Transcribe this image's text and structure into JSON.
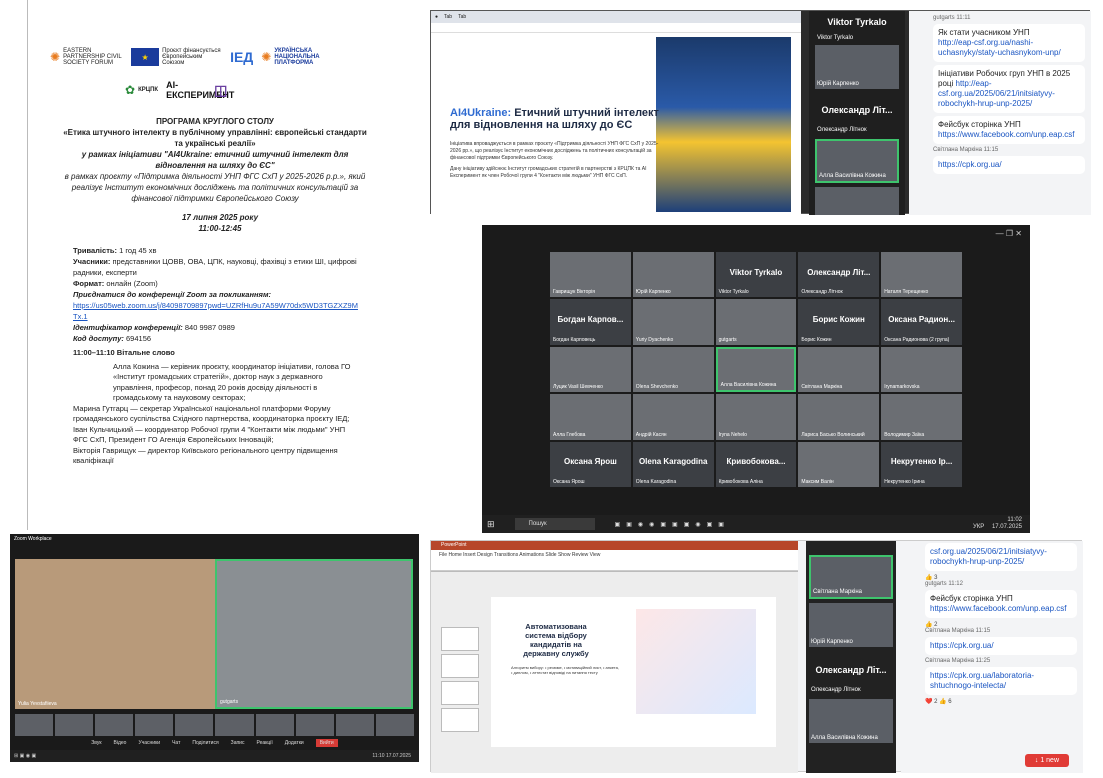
{
  "doc": {
    "logos": [
      "EASTERN PARTNERSHIP CIVIL SOCIETY FORUM",
      "Проєкт фінансується Європейським Союзом",
      "ІЕД",
      "УКРАЇНСЬКА НАЦІОНАЛЬНА ПЛАТФОРМА",
      "КРЦПК",
      "AI-ЕКСПЕРИМЕНТ"
    ],
    "title1": "ПРОГРАМА КРУГЛОГО СТОЛУ",
    "title2": "«Етика штучного інтелекту в публічному управлінні: європейські стандарти та українські реалії»",
    "title3": "у рамках ініціативи \"AI4Ukraine: етичний штучний інтелект для відновлення на шляху до ЄС\"",
    "title4": "в рамках проєкту «Підтримка діяльності УНП ФГС СхП у 2025-2026 р.р.», який реалізує Інститут економічних досліджень та політичних консультацій за фінансової підтримки Європейського Союзу",
    "date": "17 липня 2025 року",
    "time": "11:00-12:45",
    "duration_label": "Тривалість:",
    "duration": "1 год 45 хв",
    "participants_label": "Учасники:",
    "participants": "представники ЦОВВ, ОВА, ЦПК, науковці, фахівці з етики ШІ, цифрові радники, експерти",
    "format_label": "Формат:",
    "format": "онлайн (Zoom)",
    "join_label": "Приєднатися до конференції Zoom за покликанням:",
    "join_link": "https://us05web.zoom.us/j/84098709897pwd=UZRfHu9u7A59W70dx5WD3TGZXZ9MTx.1",
    "id_label": "Ідентифікатор конференції:",
    "id": "840 9987 0989",
    "code_label": "Код доступу:",
    "code": "694156",
    "agenda_head": "11:00–11:10 Вітальне слово",
    "agenda_1": "Алла Кожина — керівник проєкту, координатор ініціативи, голова ГО «Інститут громадських стратегій», доктор наук з державного управління, професор, понад 20 років досвіду діяльності в громадському та науковому секторах;",
    "agenda_2": "Марина Гутгарц — секретар Української національної платформи Форуму громадянського суспільства Східного партнерства, координаторка проєкту ІЕД;",
    "agenda_3": "Іван Кульчицький — координатор Робочої групи 4 \"Контакти між людьми\" УНП ФГС СхП, Президент ГО Агенція Європейських Інновацій;",
    "agenda_4": "Вікторія Гаврищук — директор Київського регіонального центру підвищення кваліфікації"
  },
  "screen1": {
    "slide_title_a": "AI4Ukraine:",
    "slide_title_b": "Етичний штучний інтелект для відновлення на шляху до ЄС",
    "slide_text": "Ініціатива впроваджується в рамках проєкту «Підтримка діяльності УНП ФГС СхП у 2025-2026 рр.», що реалізує Інститут економічних досліджень та політичних консультацій за фінансової підтримки Європейського Союзу.",
    "slide_text2": "Дану ініціативу здійснює Інститут громадських стратегій в партнерстві з КРЦПК та AI Експеримент як член Робочої групи 4 \"Контакти між людьми\" УНП ФГС СхП.",
    "speakers": [
      {
        "name": "Viktor Tyrkalo",
        "label": "Viktor Tyrkalo"
      },
      {
        "name": "",
        "label": "Юрій Карпенко"
      },
      {
        "name": "Олександр Літ...",
        "label": "Олександр Літнок"
      },
      {
        "name": "",
        "label": "Алла Василівна Кожина"
      }
    ],
    "chat": {
      "sender0": "gutgarts 11:11",
      "msg1": "Як стати учасником УНП",
      "link1": "http://eap-csf.org.ua/nashi-uchasnyky/staty-uchasnykom-unp/",
      "msg2": "Ініціативи Робочих груп УНП в 2025 році",
      "link2": "http://eap-csf.org.ua/2025/06/21/initsiatyvy-robochykh-hrup-unp-2025/",
      "msg3": "Фейсбук сторінка УНП",
      "link3": "https://www.facebook.com/unp.eap.csf",
      "sender1": "Світлана Маркіна 11:15",
      "link4": "https://cpk.org.ua/"
    }
  },
  "screen2": {
    "tiles": [
      {
        "name": "",
        "label": "Гаврищук Вікторія"
      },
      {
        "name": "",
        "label": "Юрій Карпенко"
      },
      {
        "name": "Viktor Tyrkalo",
        "label": "Viktor Tyrkalo"
      },
      {
        "name": "Олександр Літ...",
        "label": "Олександр Літнок"
      },
      {
        "name": "",
        "label": "Наталя Терещенко"
      },
      {
        "name": "Богдан Карпов...",
        "label": "Богдан Карповець"
      },
      {
        "name": "",
        "label": "Yuriy Dyachenko"
      },
      {
        "name": "",
        "label": "gutgarts"
      },
      {
        "name": "Борис Кожин",
        "label": "Борис Кожин"
      },
      {
        "name": "Оксана Радион...",
        "label": "Оксана Радионова (2 група)"
      },
      {
        "name": "",
        "label": "Луцик Vasil Шевченко"
      },
      {
        "name": "",
        "label": "Olena Shevchenko"
      },
      {
        "name": "",
        "label": "Алла Василівна Кожина"
      },
      {
        "name": "",
        "label": "Світлана Маркіна"
      },
      {
        "name": "",
        "label": "Irynamarkovska"
      },
      {
        "name": "",
        "label": "Алла Глебова"
      },
      {
        "name": "",
        "label": "Андрій Касян"
      },
      {
        "name": "",
        "label": "Iryna Nehelo"
      },
      {
        "name": "",
        "label": "Лариса Басько Волинський"
      },
      {
        "name": "",
        "label": "Володимир Заїка"
      },
      {
        "name": "Оксана Ярош",
        "label": "Оксана Ярош"
      },
      {
        "name": "Olena Karagodina",
        "label": "Olena Karagodina"
      },
      {
        "name": "Кривобокова...",
        "label": "Кривобокова Аліна"
      },
      {
        "name": "",
        "label": "Максим Валін"
      },
      {
        "name": "Некрутенко Ір...",
        "label": "Некрутенко Ірина"
      }
    ],
    "search": "Пошук",
    "time": "11:02",
    "date": "17.07.2025",
    "lang": "УКР"
  },
  "screen3": {
    "app": "Zoom Workplace",
    "left_label": "Yulia Yevstafiieva",
    "right_label": "gutgarts",
    "controls": [
      "Звук",
      "Відео",
      "Учасники",
      "Чат",
      "Поділитися",
      "Запис",
      "Реакції",
      "Додатки",
      "Вийти"
    ],
    "time": "11:10",
    "date": "17.07.2025"
  },
  "screen4": {
    "ppt_title": "Автоматизована система відбору кандидатів на державну службу",
    "ppt_list": "Алгоритм вибору: • резюме, • мотиваційний лист, • анкета, • диплом, • аттестат відповіді на питання тесту",
    "speakers": [
      {
        "name": "",
        "label": "Світлана Маркіна"
      },
      {
        "name": "",
        "label": "Юрій Карпенко"
      },
      {
        "name": "Олександр Літ...",
        "label": "Олександр Літнок"
      },
      {
        "name": "",
        "label": "Алла Василівна Кожина"
      }
    ],
    "chat": {
      "link0": "csf.org.ua/2025/06/21/initsiatyvy-robochykh-hrup-unp-2025/",
      "react0": "👍 3",
      "sender1": "gutgarts 11:12",
      "msg1": "Фейсбук сторінка УНП",
      "link1": "https://www.facebook.com/unp.eap.csf",
      "react1": "👍 2",
      "sender2": "Світлана Маркіна 11:15",
      "link2": "https://cpk.org.ua/",
      "sender3": "Світлана Маркіна 11:25",
      "link3": "https://cpk.org.ua/laboratoria-shtuchnogo-intelecta/",
      "react3": "❤️ 2  👍 6",
      "new_btn": "↓ 1 new"
    }
  }
}
